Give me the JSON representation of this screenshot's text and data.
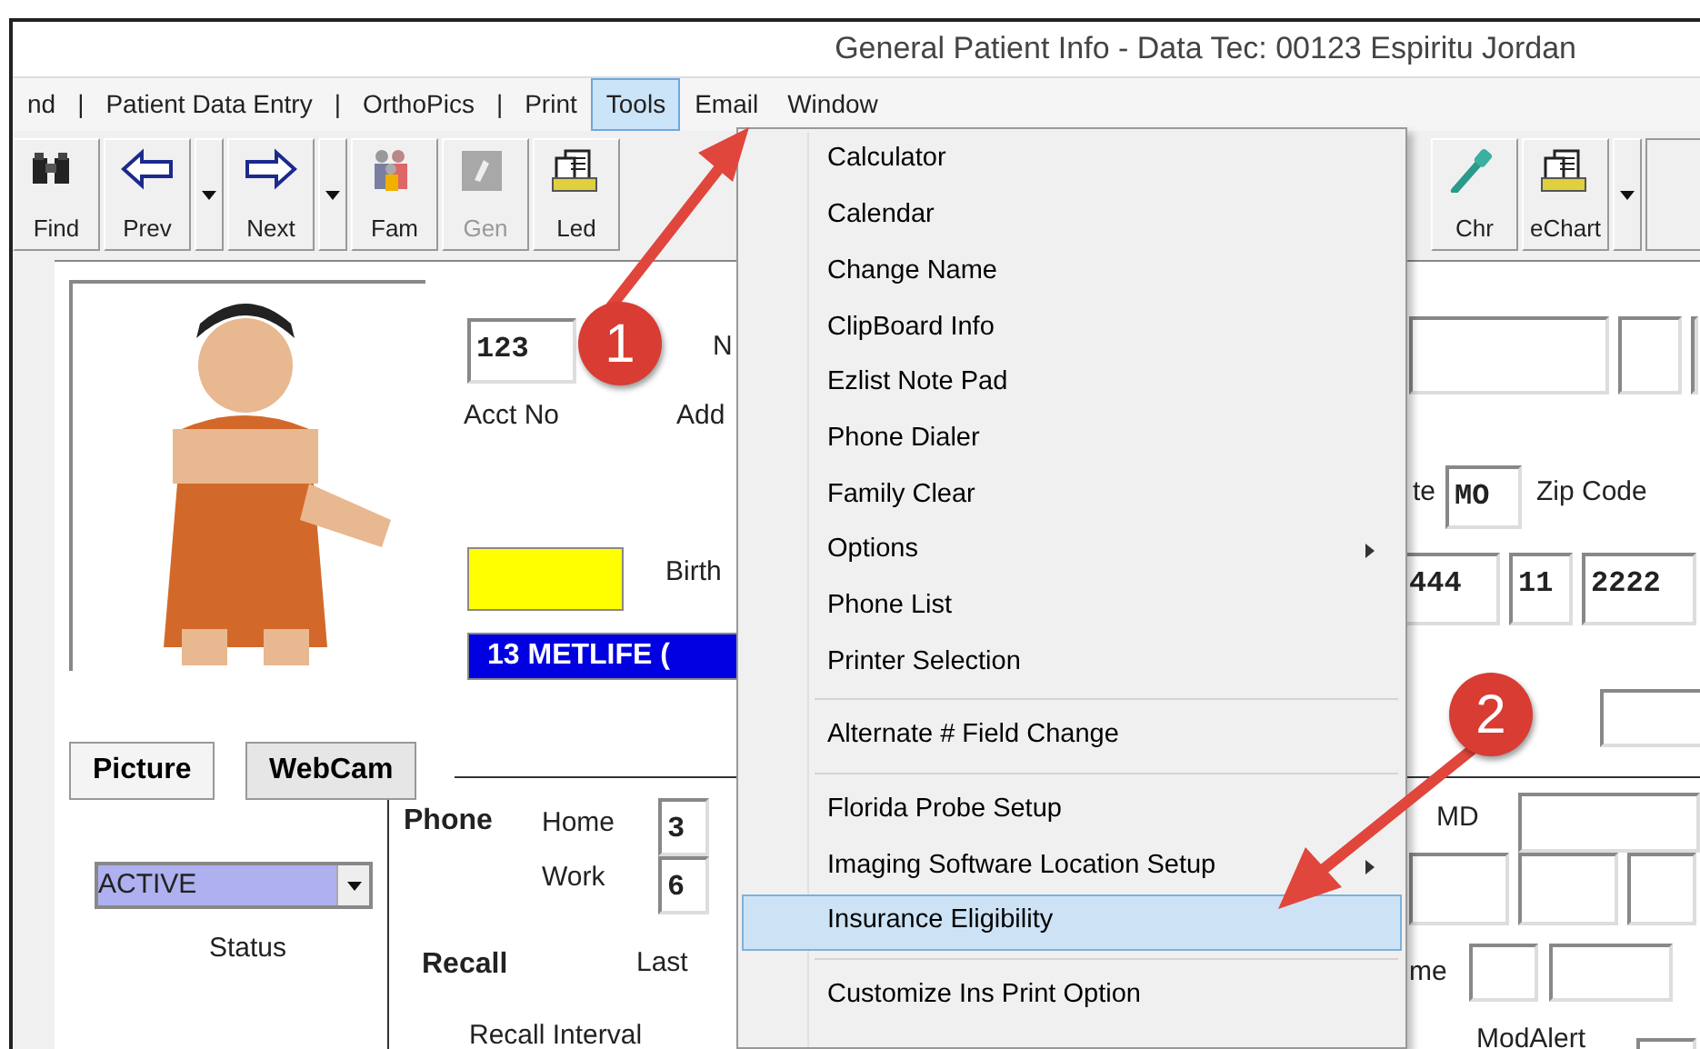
{
  "window": {
    "title": "General Patient Info - Data Tec: 00123 Espiritu Jordan"
  },
  "menu_bar": [
    {
      "label": "nd",
      "kind": "item",
      "selected": false
    },
    {
      "label": "|",
      "kind": "separator"
    },
    {
      "label": "Patient Data Entry",
      "kind": "item",
      "selected": false
    },
    {
      "label": "|",
      "kind": "separator"
    },
    {
      "label": "OrthoPics",
      "kind": "item",
      "selected": false
    },
    {
      "label": "|",
      "kind": "separator"
    },
    {
      "label": "Print",
      "kind": "item",
      "selected": false
    },
    {
      "label": "Tools",
      "kind": "item",
      "selected": true
    },
    {
      "label": "Email",
      "kind": "item",
      "selected": false
    },
    {
      "label": "Window",
      "kind": "item",
      "selected": false
    }
  ],
  "toolbar_left": [
    {
      "label": "Find",
      "kind": "find",
      "disabled": false
    },
    {
      "label": "Prev",
      "kind": "prev",
      "disabled": false
    },
    {
      "kind": "dropdown"
    },
    {
      "label": "Next",
      "kind": "next",
      "disabled": false
    },
    {
      "kind": "dropdown"
    },
    {
      "label": "Fam",
      "kind": "family",
      "disabled": false
    },
    {
      "label": "Gen",
      "kind": "gen",
      "disabled": true
    },
    {
      "label": "Led",
      "kind": "ledger",
      "disabled": false
    }
  ],
  "toolbar_right": [
    {
      "label": "Chr",
      "kind": "chart",
      "disabled": false
    },
    {
      "label": "eChart",
      "kind": "ledger",
      "disabled": false
    },
    {
      "kind": "dropdown"
    }
  ],
  "form": [
    {
      "kind": "field",
      "text": "123"
    },
    {
      "kind": "label",
      "text": "N"
    },
    {
      "kind": "label",
      "text": "Acct No"
    },
    {
      "kind": "label",
      "text": "Add"
    },
    {
      "kind": "label",
      "text": "Birth"
    },
    {
      "kind": "banner",
      "text": "13 METLIFE ("
    },
    {
      "kind": "label",
      "text": "te"
    },
    {
      "kind": "field",
      "text": "MO"
    },
    {
      "kind": "label",
      "text": "Zip Code"
    },
    {
      "kind": "field",
      "text": "444"
    },
    {
      "kind": "field",
      "text": "11"
    },
    {
      "kind": "field",
      "text": "2222"
    },
    {
      "kind": "bold",
      "text": "Phone"
    },
    {
      "kind": "label",
      "text": "Home"
    },
    {
      "kind": "label",
      "text": "Work"
    },
    {
      "kind": "field",
      "text": "3"
    },
    {
      "kind": "field",
      "text": "6"
    },
    {
      "kind": "bold",
      "text": "Recall"
    },
    {
      "kind": "label",
      "text": "Last"
    },
    {
      "kind": "label",
      "text": "Recall Interval"
    },
    {
      "kind": "label",
      "text": "MD"
    },
    {
      "kind": "label",
      "text": "me"
    },
    {
      "kind": "label",
      "text": "ModAlert"
    }
  ],
  "tabs": [
    {
      "label": "Picture",
      "selected": true
    },
    {
      "label": "WebCam",
      "selected": false
    }
  ],
  "status": {
    "value": "ACTIVE",
    "label": "Status"
  },
  "tools_menu": [
    {
      "kind": "item",
      "label": "Calculator",
      "submenu": false,
      "selected": false
    },
    {
      "kind": "item",
      "label": "Calendar",
      "submenu": false,
      "selected": false
    },
    {
      "kind": "item",
      "label": "Change Name",
      "submenu": false,
      "selected": false
    },
    {
      "kind": "item",
      "label": "ClipBoard Info",
      "submenu": false,
      "selected": false
    },
    {
      "kind": "item",
      "label": "Ezlist Note Pad",
      "submenu": false,
      "selected": false
    },
    {
      "kind": "item",
      "label": "Phone Dialer",
      "submenu": false,
      "selected": false
    },
    {
      "kind": "item",
      "label": "Family Clear",
      "submenu": false,
      "selected": false
    },
    {
      "kind": "item",
      "label": "Options",
      "submenu": true,
      "selected": false
    },
    {
      "kind": "item",
      "label": "Phone List",
      "submenu": false,
      "selected": false
    },
    {
      "kind": "item",
      "label": "Printer Selection",
      "submenu": false,
      "selected": false
    },
    {
      "kind": "separator"
    },
    {
      "kind": "item",
      "label": "Alternate # Field Change",
      "submenu": false,
      "selected": false
    },
    {
      "kind": "separator"
    },
    {
      "kind": "item",
      "label": "Florida Probe Setup",
      "submenu": false,
      "selected": false
    },
    {
      "kind": "item",
      "label": "Imaging Software Location Setup",
      "submenu": true,
      "selected": false
    },
    {
      "kind": "item",
      "label": "Insurance Eligibility",
      "submenu": false,
      "selected": true
    },
    {
      "kind": "separator"
    },
    {
      "kind": "item",
      "label": "Customize Ins Print Option",
      "submenu": false,
      "selected": false
    }
  ],
  "callouts": [
    {
      "label": "1"
    },
    {
      "label": "2"
    }
  ]
}
